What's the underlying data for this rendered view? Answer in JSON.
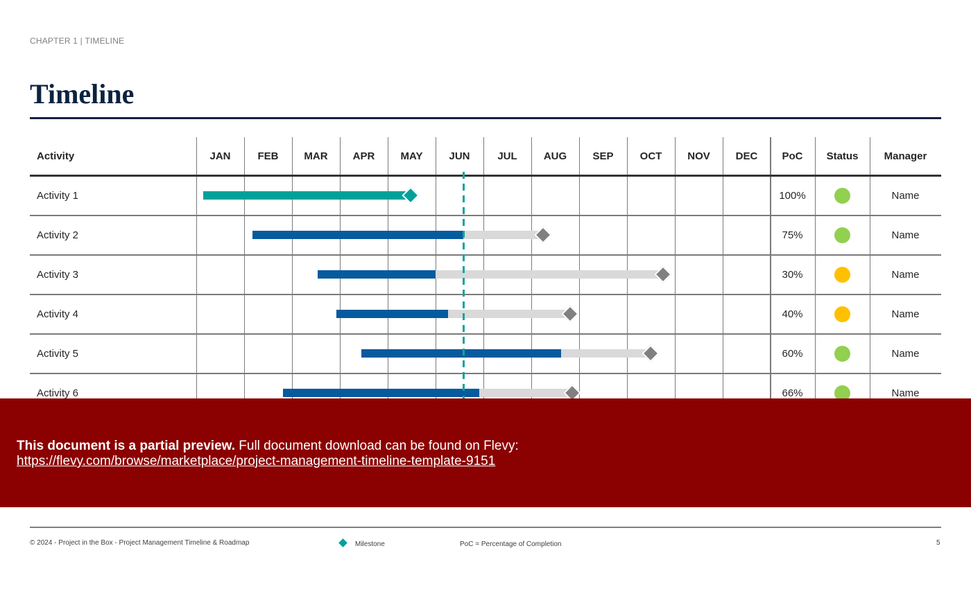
{
  "header": {
    "chapter": "CHAPTER 1 | TIMELINE",
    "title": "Timeline"
  },
  "table": {
    "columns": {
      "activity": "Activity",
      "months": [
        "JAN",
        "FEB",
        "MAR",
        "APR",
        "MAY",
        "JUN",
        "JUL",
        "AUG",
        "SEP",
        "OCT",
        "NOV",
        "DEC"
      ],
      "poc": "PoC",
      "status": "Status",
      "manager": "Manager"
    },
    "rows": [
      {
        "activity": "Activity 1",
        "poc": "100%",
        "status": "green",
        "manager": "Name"
      },
      {
        "activity": "Activity 2",
        "poc": "75%",
        "status": "green",
        "manager": "Name"
      },
      {
        "activity": "Activity 3",
        "poc": "30%",
        "status": "amber",
        "manager": "Name"
      },
      {
        "activity": "Activity 4",
        "poc": "40%",
        "status": "amber",
        "manager": "Name"
      },
      {
        "activity": "Activity 5",
        "poc": "60%",
        "status": "green",
        "manager": "Name"
      },
      {
        "activity": "Activity 6",
        "poc": "66%",
        "status": "green",
        "manager": "Name"
      }
    ]
  },
  "colors": {
    "complete": "#00a19a",
    "in_progress": "#065a9e",
    "remaining": "#d9d9d9",
    "milestone_complete": "#00a19a",
    "milestone_pending": "#808080",
    "today_line": "#13a39a",
    "status_green": "#92d050",
    "status_amber": "#ffc000",
    "banner": "#8b0000",
    "title": "#0c2340"
  },
  "chart_data": {
    "type": "gantt",
    "title": "Timeline",
    "x_unit": "months from start of JAN",
    "xlim": [
      0,
      12
    ],
    "categories": [
      "JAN",
      "FEB",
      "MAR",
      "APR",
      "MAY",
      "JUN",
      "JUL",
      "AUG",
      "SEP",
      "OCT",
      "NOV",
      "DEC"
    ],
    "today": 5.58,
    "tasks": [
      {
        "name": "Activity 1",
        "start": 0.15,
        "progress_end": 4.48,
        "milestone": 4.48,
        "poc": 100,
        "complete": true
      },
      {
        "name": "Activity 2",
        "start": 1.17,
        "progress_end": 5.58,
        "milestone": 7.25,
        "poc": 75,
        "complete": false
      },
      {
        "name": "Activity 3",
        "start": 2.54,
        "progress_end": 5.0,
        "milestone": 9.75,
        "poc": 30,
        "complete": false
      },
      {
        "name": "Activity 4",
        "start": 2.93,
        "progress_end": 5.26,
        "milestone": 7.81,
        "poc": 40,
        "complete": false
      },
      {
        "name": "Activity 5",
        "start": 3.45,
        "progress_end": 7.62,
        "milestone": 9.49,
        "poc": 60,
        "complete": false
      },
      {
        "name": "Activity 6",
        "start": 1.81,
        "progress_end": 5.91,
        "milestone": 7.86,
        "poc": 66,
        "complete": false
      }
    ],
    "legend": [
      "Milestone"
    ]
  },
  "banner": {
    "strong": "This document is a partial preview.",
    "text": " Full document download can be found on Flevy:",
    "link": "https://flevy.com/browse/marketplace/project-management-timeline-template-9151"
  },
  "footer": {
    "copyright": "© 2024 - Project in the Box - Project Management Timeline & Roadmap",
    "legend_milestone": "Milestone",
    "legend_poc": "PoC = Percentage of Completion",
    "page_number": "5"
  }
}
